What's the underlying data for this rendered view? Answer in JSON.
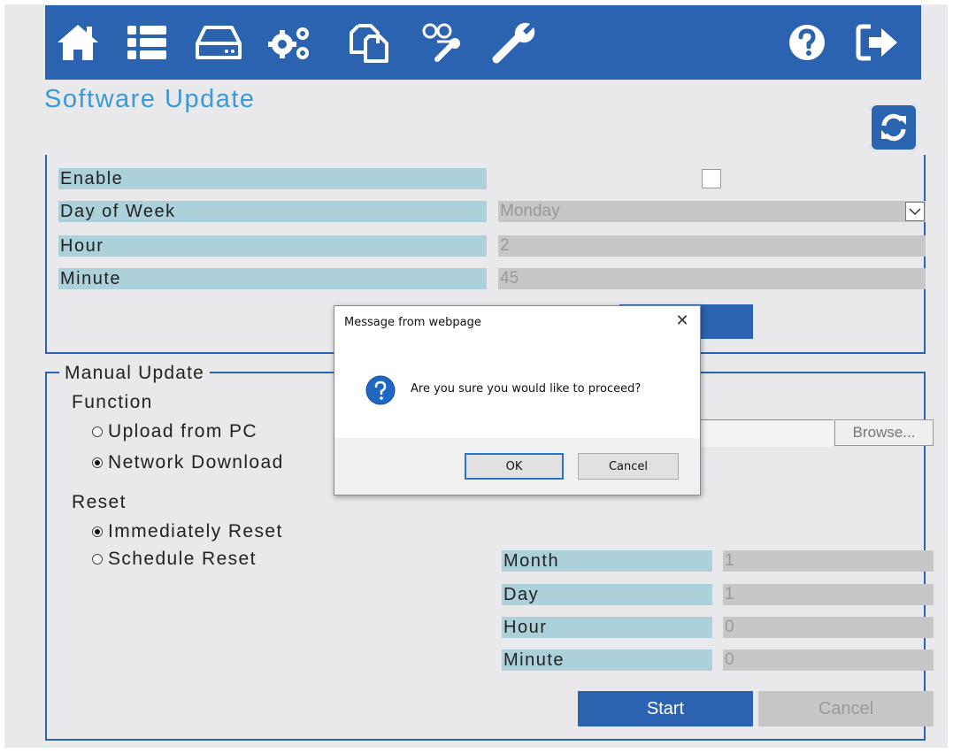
{
  "nav": {
    "icons": [
      "home-icon",
      "list-icon",
      "drive-icon",
      "gears-icon",
      "copy-icon",
      "network-icon",
      "wrench-icon",
      "help-icon",
      "logout-icon"
    ]
  },
  "page": {
    "title": "Software Update"
  },
  "schedule": {
    "enable_label": "Enable",
    "enable_checked": false,
    "day_label": "Day of Week",
    "day_value": "Monday",
    "hour_label": "Hour",
    "hour_value": "2",
    "minute_label": "Minute",
    "minute_value": "45"
  },
  "manual": {
    "legend": "Manual Update",
    "function_label": "Function",
    "upload_option": "Upload from PC",
    "network_option": "Network Download",
    "browse_label": "Browse...",
    "reset_label": "Reset",
    "immediate_option": "Immediately Reset",
    "schedule_option": "Schedule Reset",
    "month_label": "Month",
    "month_value": "1",
    "day_label": "Day",
    "day_value": "1",
    "hour_label": "Hour",
    "hour_value": "0",
    "minute_label": "Minute",
    "minute_value": "0",
    "start_label": "Start",
    "cancel_label": "Cancel"
  },
  "dialog": {
    "title": "Message from webpage",
    "close": "✕",
    "message": "Are you sure you would like to proceed?",
    "ok_label": "OK",
    "cancel_label": "Cancel"
  },
  "colors": {
    "brand": "#2b63b0",
    "title": "#3b9ad6",
    "label_bar": "#acd1da",
    "value_bar": "#c7c7c9"
  }
}
